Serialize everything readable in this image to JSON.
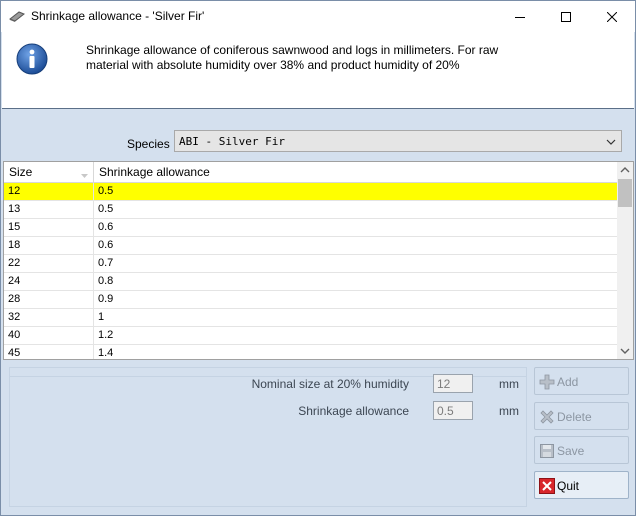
{
  "window": {
    "title": "Shrinkage allowance - 'Silver Fir'",
    "icons": [
      "app-icon",
      "minimize-icon",
      "maximize-icon",
      "close-icon"
    ]
  },
  "info": {
    "icon": "info-icon",
    "text": "Shrinkage allowance of coniferous sawnwood and logs in millimeters. For raw material with absolute humidity over 38% and product humidity of 20%"
  },
  "species": {
    "label": "Species",
    "value": "ABI - Silver Fir"
  },
  "table": {
    "columns": [
      "Size",
      "Shrinkage allowance"
    ],
    "rows": [
      {
        "size": "12",
        "allowance": "0.5"
      },
      {
        "size": "13",
        "allowance": "0.5"
      },
      {
        "size": "15",
        "allowance": "0.6"
      },
      {
        "size": "18",
        "allowance": "0.6"
      },
      {
        "size": "22",
        "allowance": "0.7"
      },
      {
        "size": "24",
        "allowance": "0.8"
      },
      {
        "size": "28",
        "allowance": "0.9"
      },
      {
        "size": "32",
        "allowance": "1"
      },
      {
        "size": "40",
        "allowance": "1.2"
      },
      {
        "size": "45",
        "allowance": "1.4"
      }
    ],
    "selected_row": 0,
    "selection_color": "#ffff00"
  },
  "form": {
    "nominal_label": "Nominal size at 20% humidity",
    "nominal_value": "12",
    "nominal_unit": "mm",
    "shrinkage_label": "Shrinkage allowance",
    "shrinkage_value": "0.5",
    "shrinkage_unit": "mm"
  },
  "buttons": {
    "add": "Add",
    "delete": "Delete",
    "save": "Save",
    "quit": "Quit"
  },
  "colors": {
    "window_bg": "#d4e0ee",
    "quit_icon_red": "#d8262b",
    "info_blue": "#2a5ea8"
  }
}
